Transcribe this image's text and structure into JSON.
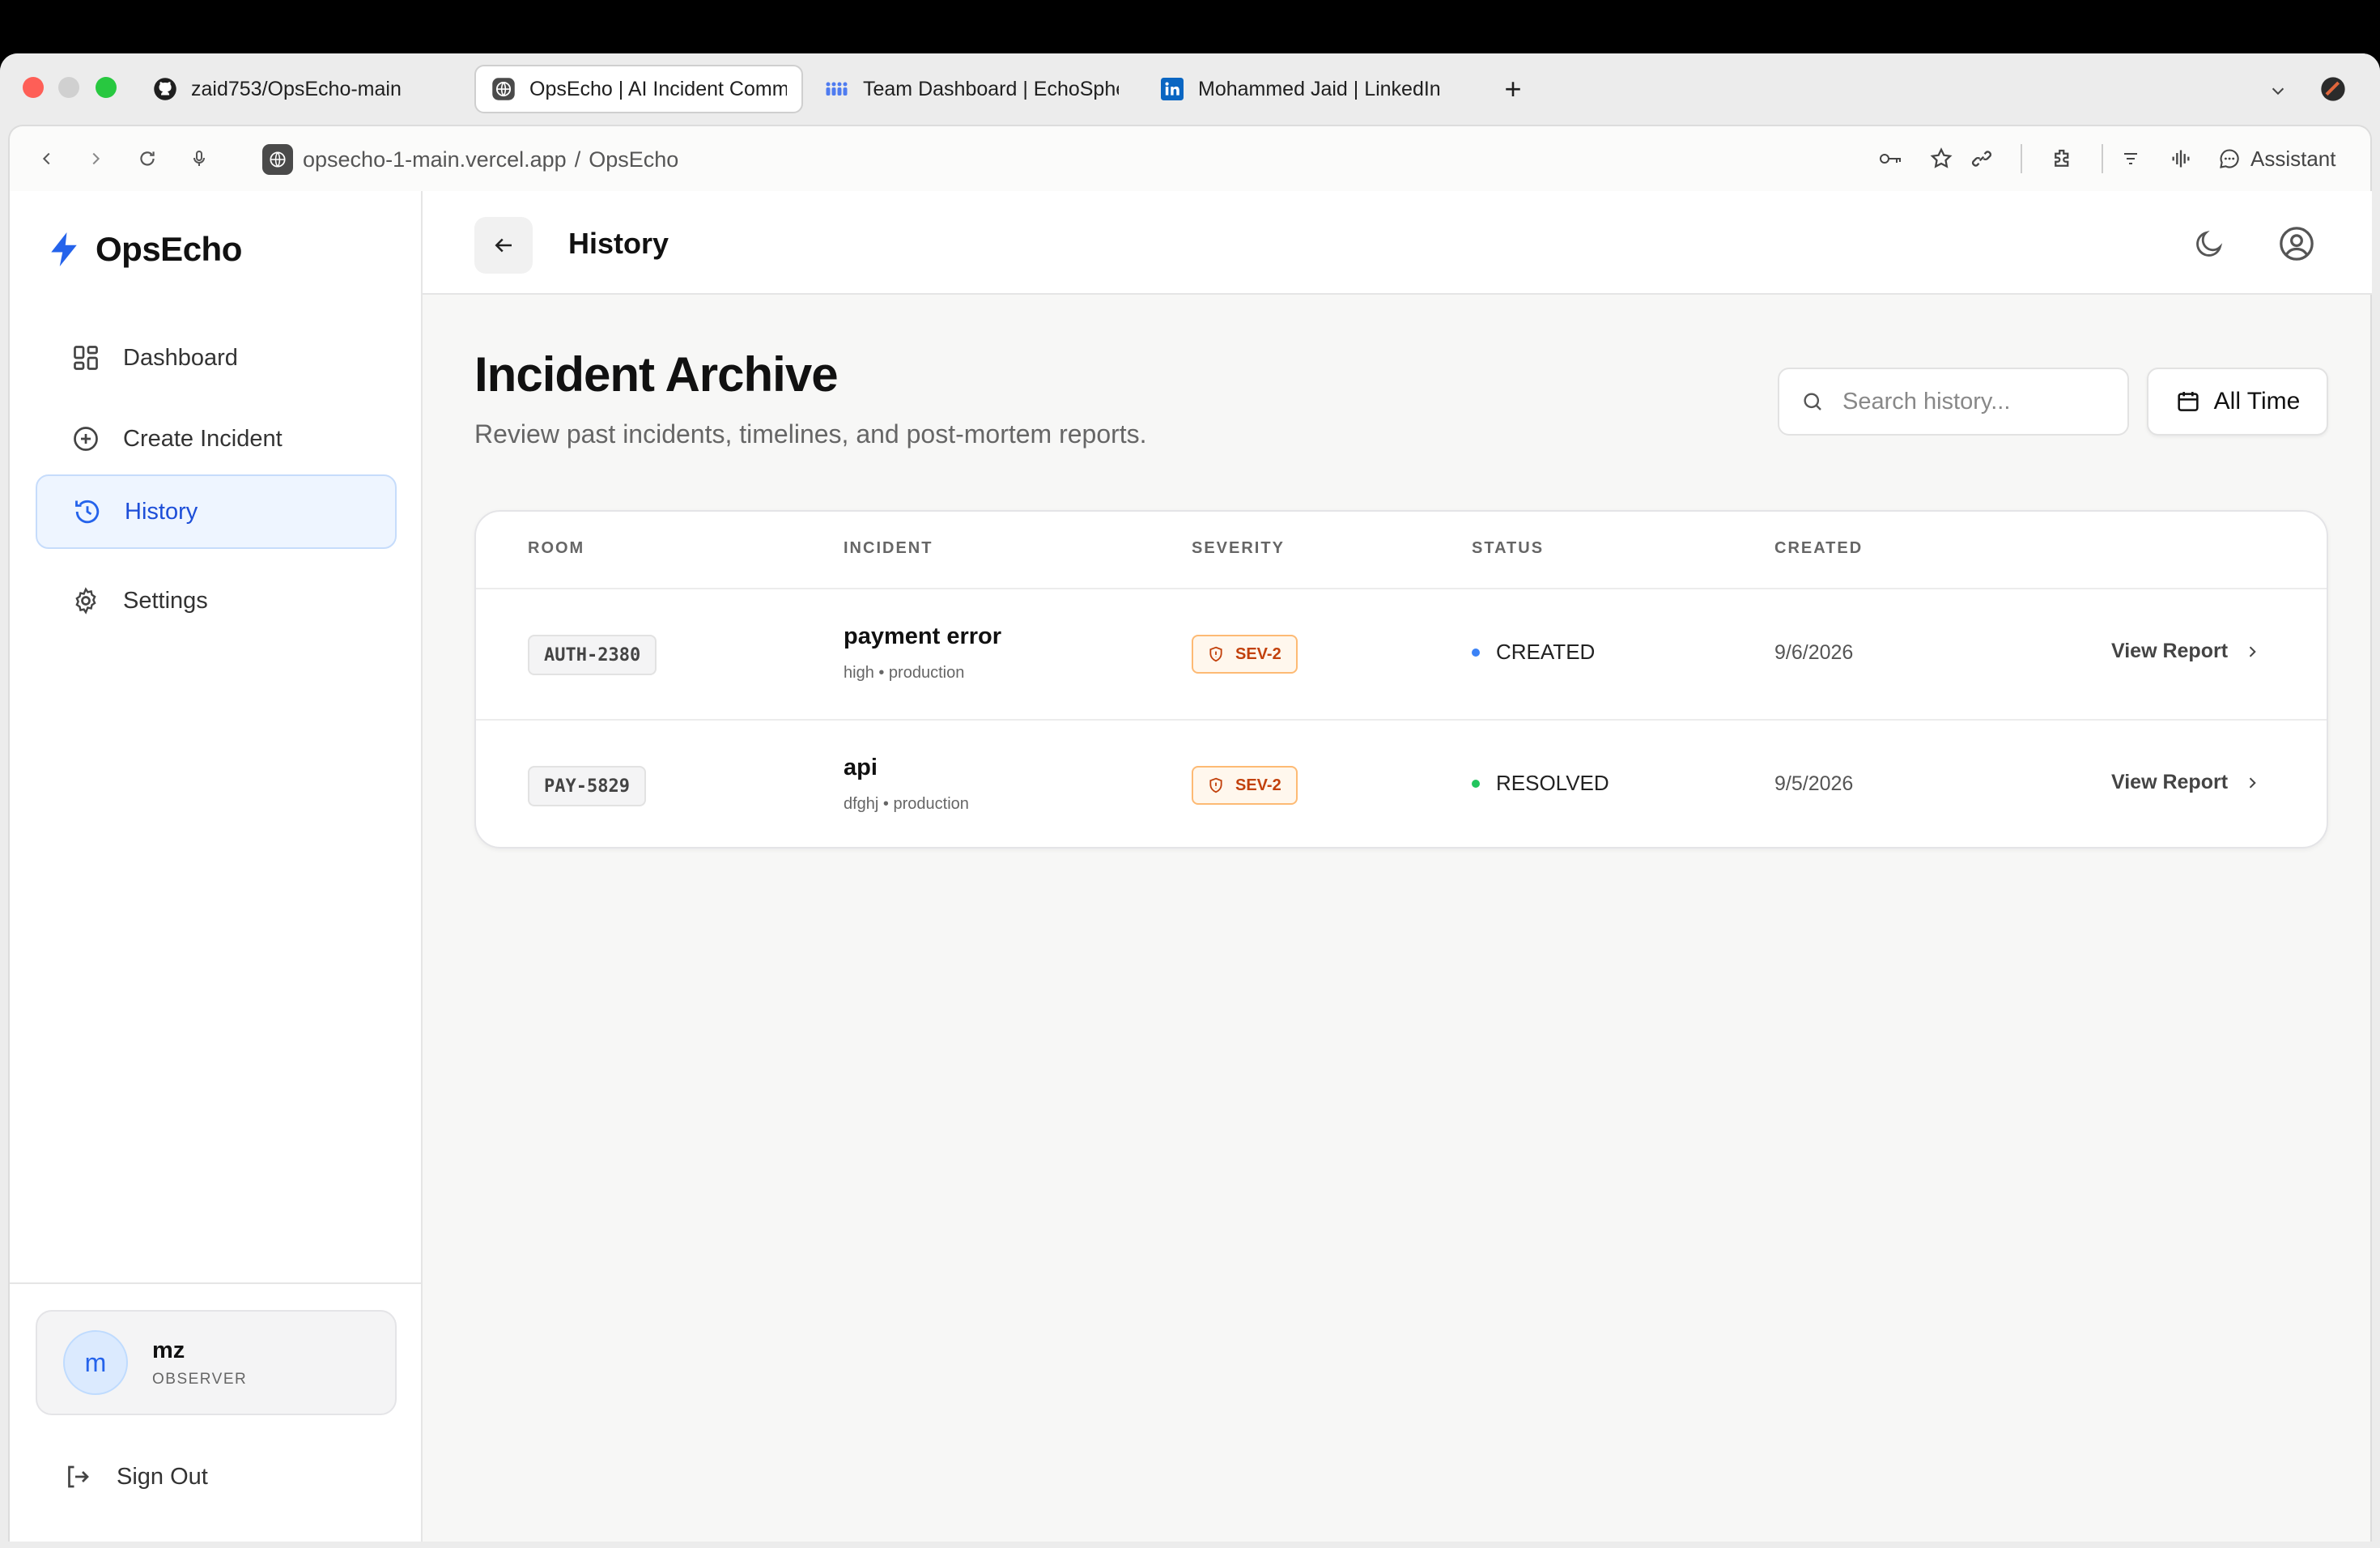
{
  "browser": {
    "tabs": [
      {
        "label": "zaid753/OpsEcho-main",
        "icon": "github-icon"
      },
      {
        "label": "OpsEcho | AI Incident Comm",
        "icon": "globe-icon",
        "active": true
      },
      {
        "label": "Team Dashboard | EchoSphe",
        "icon": "team-icon"
      },
      {
        "label": "Mohammed Jaid | LinkedIn",
        "icon": "linkedin-icon"
      }
    ],
    "new_tab": "+",
    "url_host": "opsecho-1-main.vercel.app",
    "url_sep": "/",
    "url_page": "OpsEcho",
    "assistant_label": "Assistant"
  },
  "sidebar": {
    "brand": "OpsEcho",
    "items": [
      {
        "label": "Dashboard",
        "icon": "dashboard-icon"
      },
      {
        "label": "Create Incident",
        "icon": "plus-circle-icon"
      },
      {
        "label": "History",
        "icon": "history-icon",
        "active": true
      },
      {
        "label": "Settings",
        "icon": "gear-icon"
      }
    ],
    "user": {
      "initial": "m",
      "name": "mz",
      "role": "OBSERVER"
    },
    "signout_label": "Sign Out"
  },
  "header": {
    "title": "History"
  },
  "page": {
    "title": "Incident Archive",
    "subtitle": "Review past incidents, timelines, and post-mortem reports.",
    "search_placeholder": "Search history...",
    "filter_label": "All Time"
  },
  "table": {
    "columns": [
      "ROOM",
      "INCIDENT",
      "SEVERITY",
      "STATUS",
      "CREATED"
    ],
    "rows": [
      {
        "room": "AUTH-2380",
        "title": "payment error",
        "meta": "high • production",
        "severity": "SEV-2",
        "status": "CREATED",
        "status_color": "#3b82f6",
        "created": "9/6/2026",
        "action": "View Report"
      },
      {
        "room": "PAY-5829",
        "title": "api",
        "meta": "dfghj • production",
        "severity": "SEV-2",
        "status": "RESOLVED",
        "status_color": "#22c55e",
        "created": "9/5/2026",
        "action": "View Report"
      }
    ]
  },
  "colors": {
    "accent": "#2563eb",
    "severity": "#c2410c"
  }
}
